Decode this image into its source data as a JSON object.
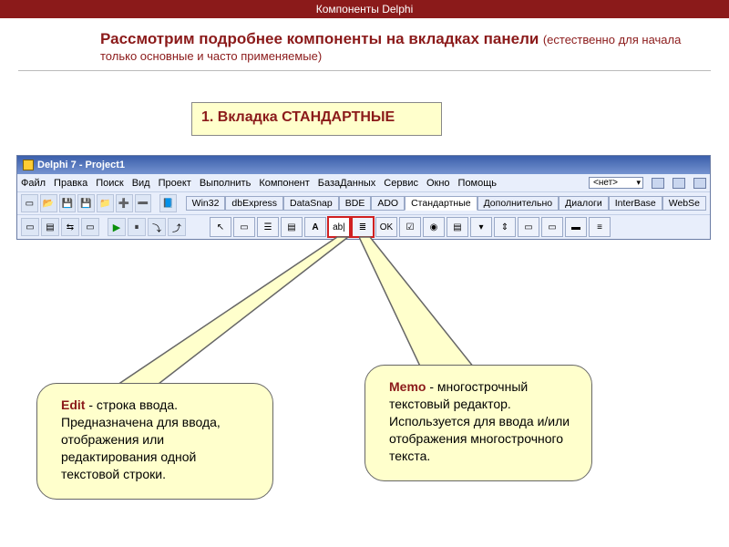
{
  "header": "Компоненты Delphi",
  "title": {
    "main": "Рассмотрим подробнее компоненты на вкладках панели",
    "sub": "(естественно для начала только основные и часто применяемые)"
  },
  "tagbox": "1. Вкладка СТАНДАРТНЫЕ",
  "ide": {
    "title": "Delphi 7 - Project1",
    "menu": [
      "Файл",
      "Правка",
      "Поиск",
      "Вид",
      "Проект",
      "Выполнить",
      "Компонент",
      "БазаДанных",
      "Сервис",
      "Окно",
      "Помощь"
    ],
    "combo": "<нет>",
    "tabs": [
      "Win32",
      "dbExpress",
      "DataSnap",
      "BDE",
      "ADO",
      "Стандартные",
      "Дополнительно",
      "Диалоги",
      "InterBase",
      "WebSe"
    ],
    "activeTab": 5
  },
  "callouts": {
    "edit": {
      "name": "Edit",
      "text": " - строка ввода. Предназначена для ввода, отображения или редактирования одной текстовой строки."
    },
    "memo": {
      "name": "Memo",
      "text": " - многострочный текстовый редактор. Используется для ввода и/или отображения многострочного текста."
    }
  }
}
